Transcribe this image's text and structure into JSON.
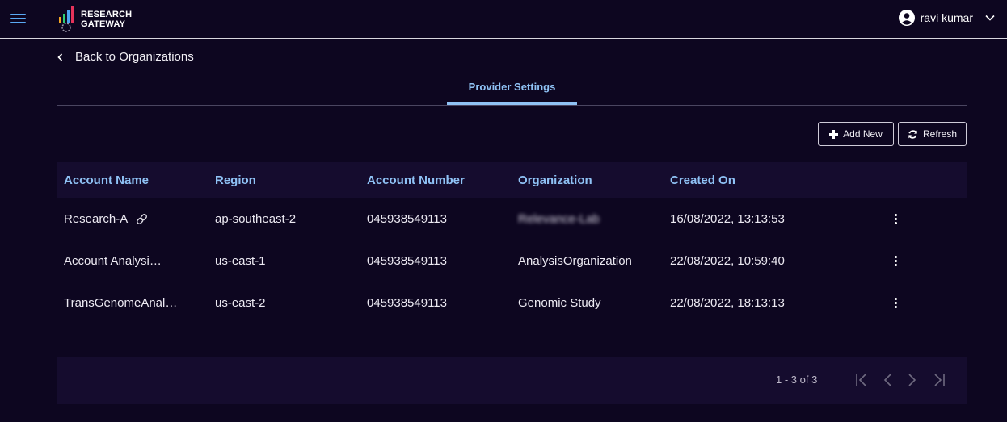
{
  "header": {
    "logo_line1": "RESEARCH",
    "logo_line2": "GATEWAY",
    "user_name": "ravi kumar"
  },
  "nav": {
    "back_label": "Back to Organizations",
    "active_tab": "Provider Settings"
  },
  "toolbar": {
    "add_label": "Add New",
    "refresh_label": "Refresh"
  },
  "table": {
    "columns": [
      "Account Name",
      "Region",
      "Account Number",
      "Organization",
      "Created On"
    ],
    "rows": [
      {
        "name": "Research-A",
        "region": "ap-southeast-2",
        "number": "045938549113",
        "org": "Relevance-Lab",
        "created": "16/08/2022, 13:13:53"
      },
      {
        "name": "Account Analysi…",
        "region": "us-east-1",
        "number": "045938549113",
        "org": "AnalysisOrganization",
        "created": "22/08/2022, 10:59:40"
      },
      {
        "name": "TransGenomeAnal…",
        "region": "us-east-2",
        "number": "045938549113",
        "org": "Genomic Study",
        "created": "22/08/2022, 18:13:13"
      }
    ]
  },
  "pagination": {
    "range": "1 - 3 of 3"
  },
  "colors": {
    "background": "#0d0620",
    "accent": "#8fc2f5",
    "menu_icon": "#5aa9f4"
  },
  "icons": [
    "menu-icon",
    "user-avatar-icon",
    "chevron-down-icon",
    "chevron-left-icon",
    "plus-icon",
    "refresh-icon",
    "link-icon",
    "more-vertical-icon",
    "first-page-icon",
    "previous-page-icon",
    "next-page-icon",
    "last-page-icon"
  ]
}
